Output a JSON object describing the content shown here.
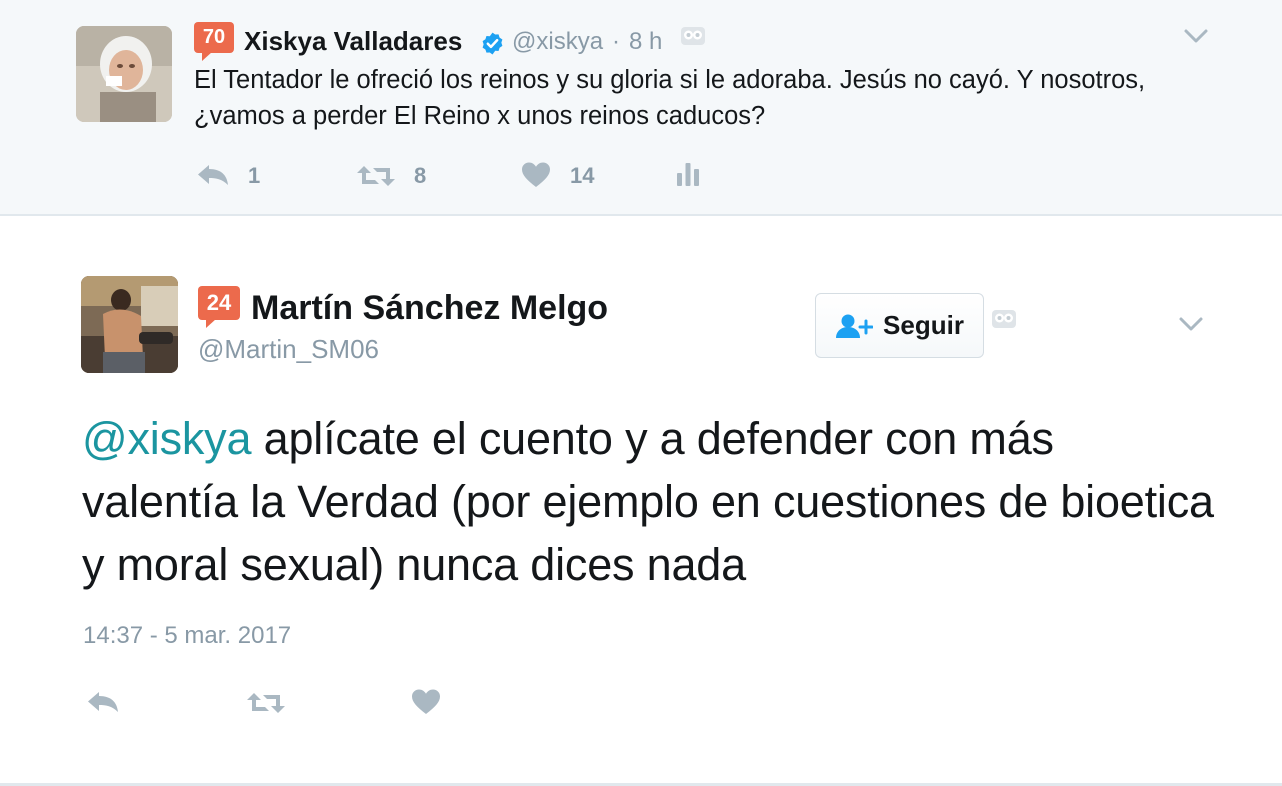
{
  "parent_tweet": {
    "score_badge": "70",
    "display_name": "Xiskya Valladares",
    "verified": true,
    "handle": "@xiskya",
    "separator": "·",
    "time": "8 h",
    "text": "El Tentador le ofreció los reinos y su gloria si le adoraba. Jesús no cayó. Y nosotros, ¿vamos a perder El Reino x unos reinos caducos?",
    "actions": {
      "reply_icon": "reply-icon",
      "reply_count": "1",
      "retweet_icon": "retweet-icon",
      "retweet_count": "8",
      "like_icon": "heart-icon",
      "like_count": "14",
      "analytics_icon": "bar-chart-icon"
    }
  },
  "main_tweet": {
    "score_badge": "24",
    "display_name": "Martín Sánchez Melgo",
    "handle": "@Martin_SM06",
    "follow_button": {
      "icon": "add-user-icon",
      "label": "Seguir"
    },
    "mention": "@xiskya",
    "text": " aplícate el cuento y a defender con más valentía la Verdad (por ejemplo en cuestiones de bioetica y moral sexual) nunca dices nada",
    "timestamp": "14:37 - 5 mar. 2017",
    "actions": {
      "reply_icon": "reply-icon",
      "retweet_icon": "retweet-icon",
      "like_icon": "heart-icon"
    }
  },
  "colors": {
    "accent_link": "#1b95a0",
    "badge": "#ec6a4c",
    "verified_blue": "#1da1f2",
    "muted_text": "#8899a6",
    "icon_gray": "#aab8c2",
    "parent_background": "#f5f8fa"
  }
}
